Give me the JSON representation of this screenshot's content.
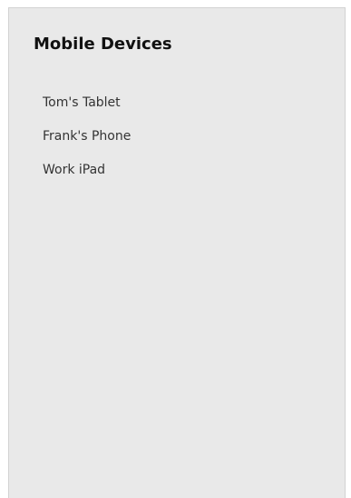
{
  "panel": {
    "title": "Mobile Devices",
    "devices": [
      {
        "label": "Tom's Tablet"
      },
      {
        "label": "Frank's Phone"
      },
      {
        "label": "Work iPad"
      }
    ]
  },
  "colors": {
    "panel_background": "#e9e9e9",
    "title_text": "#111111",
    "item_text": "#333333"
  }
}
